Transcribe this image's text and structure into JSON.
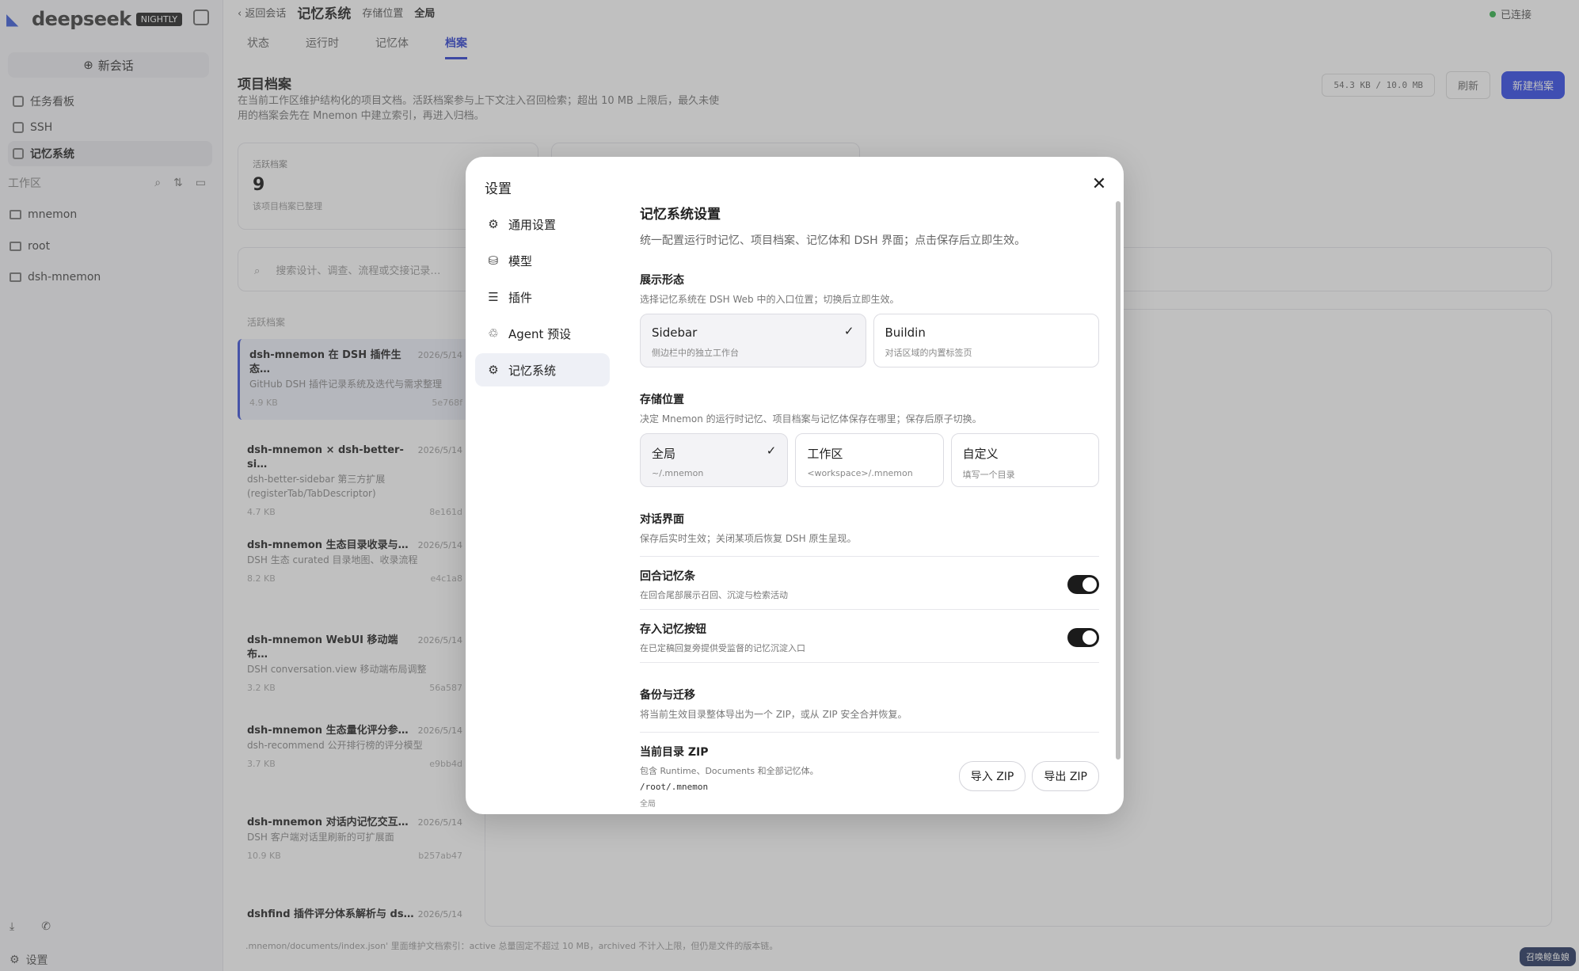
{
  "app": {
    "logo_text": "deepseek",
    "logo_badge": "NIGHTLY"
  },
  "sidebar": {
    "new_chat": "新会话",
    "items": [
      {
        "label": "任务看板"
      },
      {
        "label": "SSH"
      },
      {
        "label": "记忆系统"
      }
    ],
    "workspace_label": "工作区",
    "folders": [
      {
        "label": "mnemon"
      },
      {
        "label": "root"
      },
      {
        "label": "dsh-mnemon"
      }
    ],
    "settings_label": "设置"
  },
  "main": {
    "back_label": "返回会话",
    "title": "记忆系统",
    "scope_label": "存储位置",
    "scope_value": "全局",
    "status": "已连接",
    "tabs": [
      "状态",
      "运行时",
      "记忆体",
      "档案"
    ],
    "page_title": "项目档案",
    "page_desc": "在当前工作区维护结构化的项目文档。活跃档案参与上下文注入召回检索；超出 10 MB 上限后，最久未使用的档案会先在 Mnemon 中建立索引，再进入归档。",
    "usage": "54.3 KB / 10.0 MB",
    "refresh": "刷新",
    "new_doc": "新建档案",
    "stat_label": "活跃档案",
    "stat_value": "9",
    "stat_sub": "该项目档案已整理",
    "search_placeholder": "搜索设计、调查、流程或交接记录…",
    "list_title": "活跃档案",
    "docs": [
      {
        "title": "dsh-mnemon 在 DSH 插件生态…",
        "date": "2026/5/14",
        "desc": "GitHub DSH 插件记录系统及迭代与需求整理",
        "size": "4.9 KB",
        "hash": "5e768f"
      },
      {
        "title": "dsh-mnemon × dsh-better-si…",
        "date": "2026/5/14",
        "desc": "dsh-better-sidebar 第三方扩展 (registerTab/TabDescriptor)",
        "size": "4.7 KB",
        "hash": "8e161d"
      },
      {
        "title": "dsh-mnemon 生态目录收录与…",
        "date": "2026/5/14",
        "desc": "DSH 生态 curated 目录地图、收录流程",
        "size": "8.2 KB",
        "hash": "e4c1a8"
      },
      {
        "title": "dsh-mnemon WebUI 移动端布…",
        "date": "2026/5/14",
        "desc": "DSH conversation.view 移动端布局调整",
        "size": "3.2 KB",
        "hash": "56a587"
      },
      {
        "title": "dsh-mnemon 生态量化评分参…",
        "date": "2026/5/14",
        "desc": "dsh-recommend 公开排行榜的评分模型",
        "size": "3.7 KB",
        "hash": "e9bb4d"
      },
      {
        "title": "dsh-mnemon 对话内记忆交互…",
        "date": "2026/5/14",
        "desc": "DSH 客户端对话里刷新的可扩展面",
        "size": "10.9 KB",
        "hash": "b257ab47"
      },
      {
        "title": "dshfind 插件评分体系解析与 ds…",
        "date": "2026/5/14",
        "desc": "",
        "size": "",
        "hash": ""
      }
    ],
    "footer_note": ".mnemon/documents/index.json' 里面维护文档索引：active 总量固定不超过 10 MB，archived 不计入上限，但仍是文件的版本链。",
    "corner_badge": "召唤鲸鱼娘"
  },
  "modal": {
    "title": "设置",
    "nav": [
      {
        "label": "通用设置",
        "icon": "gear-icon"
      },
      {
        "label": "模型",
        "icon": "database-icon"
      },
      {
        "label": "插件",
        "icon": "sliders-icon"
      },
      {
        "label": "Agent 预设",
        "icon": "agent-icon"
      },
      {
        "label": "记忆系统",
        "icon": "gear-icon"
      }
    ],
    "section_title": "记忆系统设置",
    "section_desc": "统一配置运行时记忆、项目档案、记忆体和 DSH 界面；点击保存后立即生效。",
    "display": {
      "title": "展示形态",
      "desc": "选择记忆系统在 DSH Web 中的入口位置；切换后立即生效。",
      "options": [
        {
          "label": "Sidebar",
          "sub": "侧边栏中的独立工作台",
          "selected": true
        },
        {
          "label": "Buildin",
          "sub": "对话区域的内置标签页",
          "selected": false
        }
      ]
    },
    "storage": {
      "title": "存储位置",
      "desc": "决定 Mnemon 的运行时记忆、项目档案与记忆体保存在哪里；保存后原子切换。",
      "options": [
        {
          "label": "全局",
          "sub": "~/.mnemon",
          "selected": true
        },
        {
          "label": "工作区",
          "sub": "<workspace>/.mnemon",
          "selected": false
        },
        {
          "label": "自定义",
          "sub": "填写一个目录",
          "selected": false
        }
      ]
    },
    "dialog": {
      "title": "对话界面",
      "desc": "保存后实时生效；关闭某项后恢复 DSH 原生呈现。",
      "toggles": [
        {
          "label": "回合记忆条",
          "desc": "在回合尾部展示召回、沉淀与检索活动",
          "on": true
        },
        {
          "label": "存入记忆按钮",
          "desc": "在已定稿回复旁提供受监督的记忆沉淀入口",
          "on": true
        }
      ]
    },
    "backup": {
      "title": "备份与迁移",
      "desc": "将当前生效目录整体导出为一个 ZIP，或从 ZIP 安全合并恢复。",
      "zip_title": "当前目录 ZIP",
      "zip_desc": "包含 Runtime、Documents 和全部记忆体。",
      "path": "/root/.mnemon",
      "scope": "全局",
      "import_label": "导入 ZIP",
      "export_label": "导出 ZIP"
    }
  }
}
